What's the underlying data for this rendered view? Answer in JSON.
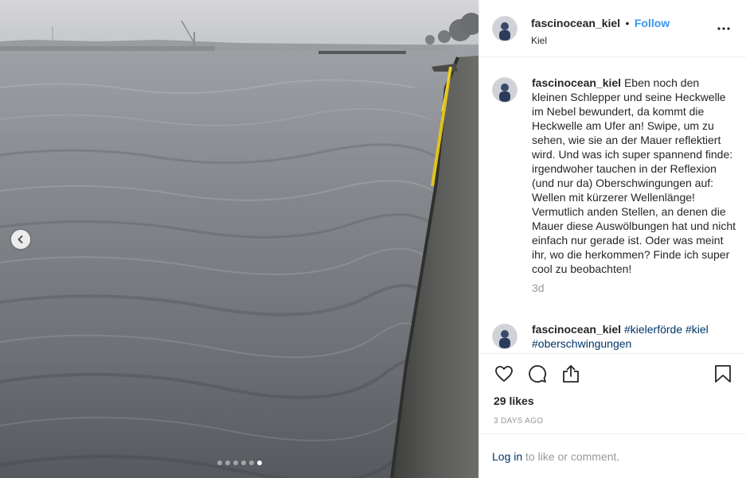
{
  "post": {
    "username": "fascinocean_kiel",
    "separator": "•",
    "follow_label": "Follow",
    "location": "Kiel",
    "caption": "Eben noch den kleinen Schlepper und seine Heckwelle im Nebel bewundert, da kommt die Heckwelle am Ufer an! Swipe, um zu sehen, wie sie an der Mauer reflektiert wird. Und was ich super spannend finde: irgendwoher tauchen in der Reflexion (und nur da) Oberschwingungen auf: Wellen mit kürzerer Wellenlänge! Vermutlich anden Stellen, an denen die Mauer diese Auswölbungen hat und nicht einfach nur gerade ist. Oder was meint ihr, wo die herkommen? Finde ich super cool zu beobachten!",
    "caption_age": "3d",
    "comment": {
      "username": "fascinocean_kiel",
      "tags": [
        "#kielerförde",
        "#kiel",
        "#oberschwingungen"
      ]
    },
    "likes": "29 likes",
    "date": "3 DAYS AGO",
    "carousel": {
      "total": 6,
      "active": 6
    }
  },
  "login": {
    "link": "Log in",
    "rest": " to like or comment."
  },
  "icons": {
    "prev": "chevron-left-icon",
    "more": "more-options-icon",
    "like": "heart-icon",
    "comment": "comment-icon",
    "share": "share-icon",
    "save": "bookmark-icon"
  },
  "colors": {
    "link": "#3897f0",
    "tag": "#003569",
    "muted": "#999999",
    "text": "#262626"
  }
}
